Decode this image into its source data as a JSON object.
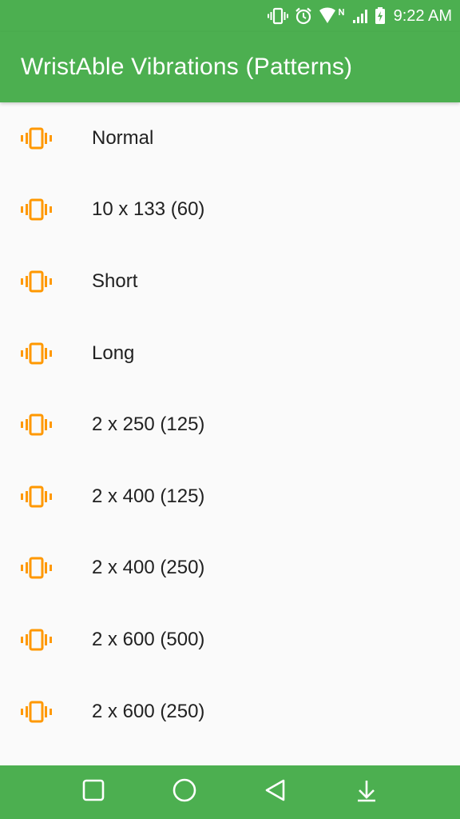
{
  "status_bar": {
    "time": "9:22 AM",
    "icons": [
      "vibrate-icon",
      "alarm-icon",
      "wifi-icon",
      "signal-icon",
      "battery-icon"
    ]
  },
  "app_bar": {
    "title": "WristAble Vibrations (Patterns)"
  },
  "list": {
    "icon": "vibrate-icon",
    "icon_color": "#ff9800",
    "items": [
      {
        "label": "Normal"
      },
      {
        "label": "10 x 133 (60)"
      },
      {
        "label": "Short"
      },
      {
        "label": "Long"
      },
      {
        "label": "2 x 250 (125)"
      },
      {
        "label": "2 x 400 (125)"
      },
      {
        "label": "2 x 400 (250)"
      },
      {
        "label": "2 x 600 (500)"
      },
      {
        "label": "2 x 600 (250)"
      }
    ]
  },
  "nav_bar": {
    "buttons": [
      "recents-icon",
      "home-icon",
      "back-icon",
      "notifications-pull-icon"
    ]
  },
  "colors": {
    "primary": "#4caf50",
    "accent": "#ff9800",
    "background": "#fafafa",
    "text": "#212121"
  }
}
